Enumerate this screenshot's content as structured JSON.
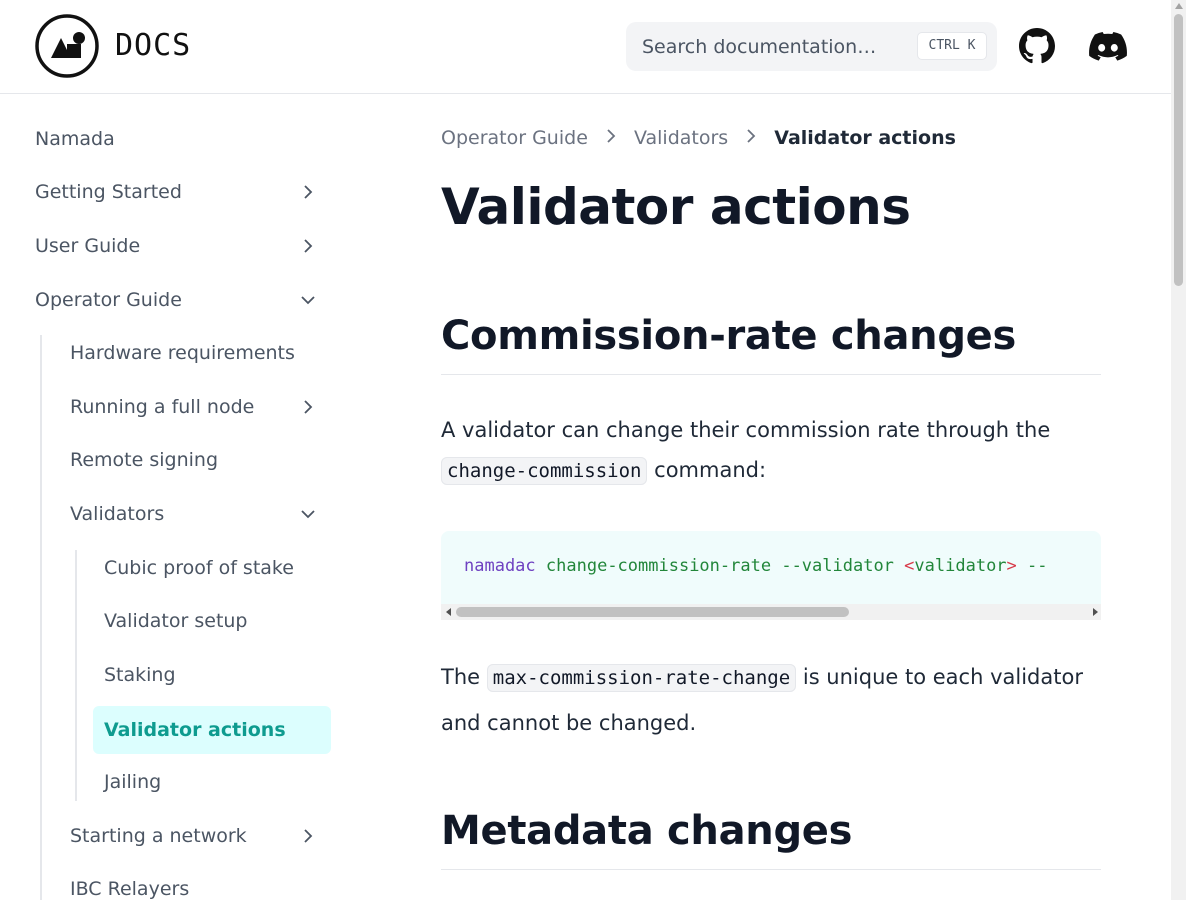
{
  "header": {
    "logo_text": "DOCS",
    "search": {
      "placeholder": "Search documentation…",
      "shortcut": "CTRL K"
    },
    "icons": {
      "github": "github-icon",
      "discord": "discord-icon"
    }
  },
  "sidebar": {
    "items": [
      {
        "label": "Namada"
      },
      {
        "label": "Getting Started",
        "icon": "chevron-right-icon"
      },
      {
        "label": "User Guide",
        "icon": "chevron-right-icon"
      },
      {
        "label": "Operator Guide",
        "icon": "chevron-down-icon"
      },
      {
        "label": "Hardware requirements"
      },
      {
        "label": "Running a full node",
        "icon": "chevron-right-icon"
      },
      {
        "label": "Remote signing"
      },
      {
        "label": "Validators",
        "icon": "chevron-down-icon"
      },
      {
        "label": "Cubic proof of stake"
      },
      {
        "label": "Validator setup"
      },
      {
        "label": "Staking"
      },
      {
        "label": "Validator actions",
        "active": true
      },
      {
        "label": "Jailing"
      },
      {
        "label": "Starting a network",
        "icon": "chevron-right-icon"
      },
      {
        "label": "IBC Relayers"
      }
    ],
    "active_color": "#0e9b8f"
  },
  "main": {
    "breadcrumb": [
      "Operator Guide",
      "Validators",
      "Validator actions"
    ],
    "title": "Validator actions",
    "sections": [
      {
        "heading": "Commission-rate changes",
        "para1": {
          "text_before": "A validator can change their commission rate through the",
          "code": "change-commission",
          "text_after": "command:"
        },
        "code_block": {
          "cmd": "namadac",
          "sub": "change-commission-rate",
          "flag": "--validator",
          "ang_open": "<",
          "var": "validator",
          "ang_close": ">",
          "rest": "--"
        },
        "para2": {
          "text_before": "The",
          "code": "max-commission-rate-change",
          "text_after": "is unique to each validator and cannot be changed."
        }
      },
      {
        "heading": "Metadata changes"
      }
    ]
  }
}
